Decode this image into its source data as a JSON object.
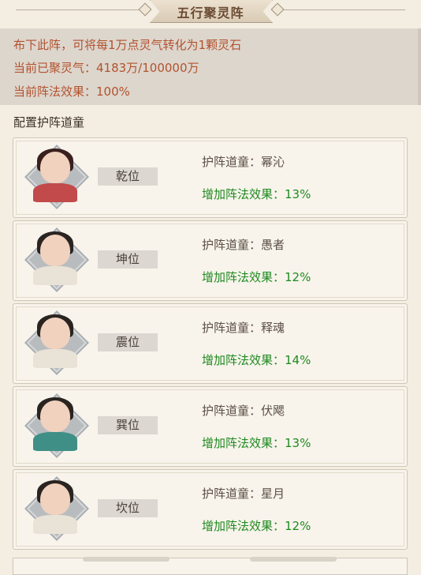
{
  "header": {
    "title": "五行聚灵阵"
  },
  "info": {
    "description": "布下此阵，可将每1万点灵气转化为1颗灵石",
    "gathered": "当前已聚灵气：4183万/100000万",
    "effect": "当前阵法效果：100%"
  },
  "section_label": "配置护阵道童",
  "cards": [
    {
      "slot": "乾位",
      "name": "护阵道童：幂沁",
      "effect": "增加阵法效果：13%",
      "avatar": "female-portrait-icon"
    },
    {
      "slot": "坤位",
      "name": "护阵道童：愚者",
      "effect": "增加阵法效果：12%",
      "avatar": "male-portrait-icon"
    },
    {
      "slot": "震位",
      "name": "护阵道童：释魂",
      "effect": "增加阵法效果：14%",
      "avatar": "male-portrait-icon"
    },
    {
      "slot": "巽位",
      "name": "护阵道童：伏飔",
      "effect": "增加阵法效果：13%",
      "avatar": "male-portrait-icon"
    },
    {
      "slot": "坎位",
      "name": "护阵道童：星月",
      "effect": "增加阵法效果：12%",
      "avatar": "male-portrait-icon"
    }
  ],
  "colors": {
    "info_text": "#b3522e",
    "effect_text": "#1f8a1f",
    "background": "#f3ede2"
  }
}
